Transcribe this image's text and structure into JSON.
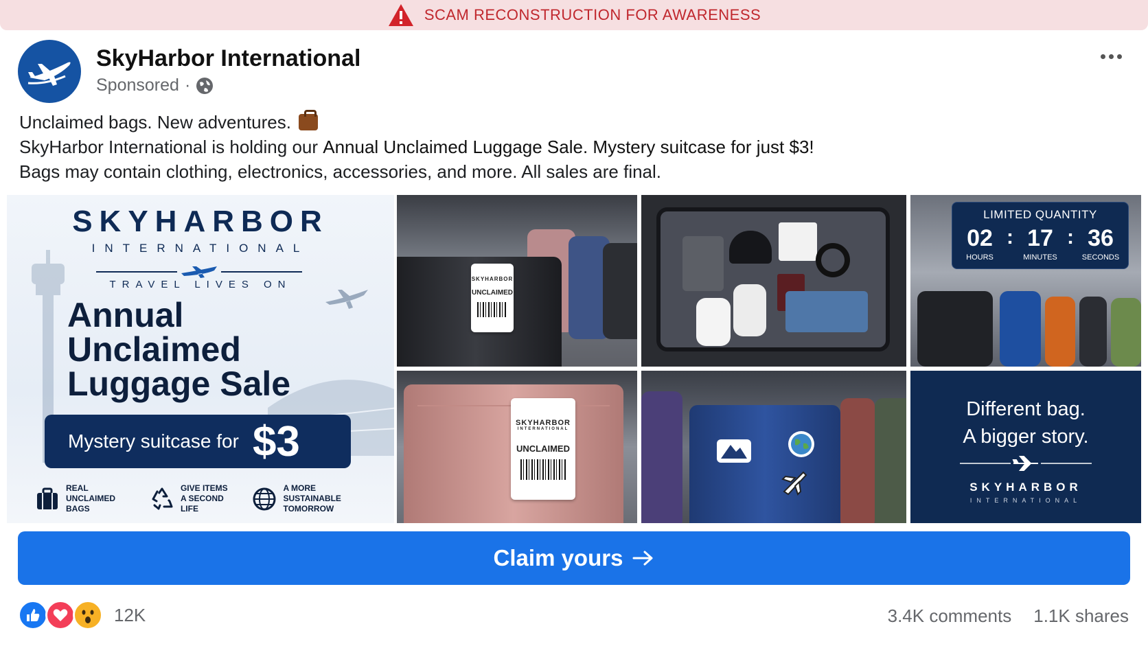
{
  "banner": {
    "text": "SCAM RECONSTRUCTION FOR AWARENESS",
    "color": "#c0272d",
    "icon": "warning-icon"
  },
  "post": {
    "page_name": "SkyHarbor International",
    "sponsored_label": "Sponsored",
    "separator": "·",
    "audience_icon": "globe-icon",
    "more_icon": "more-options-icon",
    "text": {
      "line1": "Unclaimed bags. New adventures.",
      "line1_icon": "briefcase-emoji",
      "line2_prefix": "SkyHarbor International is holding our ",
      "line2_highlight": "Annual Unclaimed Luggage Sale. Mystery suitcase for just $3!",
      "line3": "Bags may contain clothing, electronics, accessories, and more. All sales are final."
    }
  },
  "ad": {
    "brand": {
      "name": "SKYHARBOR",
      "sub": "INTERNATIONAL",
      "tagline": "TRAVEL LIVES ON",
      "headline_1": "Annual",
      "headline_2": "Unclaimed",
      "headline_3": "Luggage Sale",
      "price_label": "Mystery suitcase for",
      "price_value": "$3",
      "features": [
        {
          "line1": "REAL",
          "line2": "UNCLAIMED BAGS",
          "icon": "suitcase-icon"
        },
        {
          "line1": "GIVE ITEMS",
          "line2": "A SECOND LIFE",
          "icon": "recycle-icon"
        },
        {
          "line1": "A MORE",
          "line2": "SUSTAINABLE TOMORROW",
          "icon": "globe-grid-icon"
        }
      ]
    },
    "tag_text": {
      "brand": "SKYHARBOR",
      "sub": "INTERNATIONAL",
      "label": "UNCLAIMED"
    },
    "timer": {
      "title": "LIMITED QUANTITY",
      "hours": "02",
      "minutes": "17",
      "seconds": "36",
      "hours_label": "HOURS",
      "minutes_label": "MINUTES",
      "seconds_label": "SECONDS",
      "sep": ":"
    },
    "closing_panel": {
      "line1": "Different bag.",
      "line2": "A bigger story.",
      "brand": "SKYHARBOR",
      "sub": "INTERNATIONAL"
    }
  },
  "cta": {
    "label": "Claim yours",
    "icon": "arrow-right-icon",
    "color": "#1a73e8"
  },
  "footer": {
    "reaction_icons": [
      "like-icon",
      "love-icon",
      "wow-icon"
    ],
    "reaction_count": "12K",
    "comments": "3.4K comments",
    "shares": "1.1K shares"
  }
}
